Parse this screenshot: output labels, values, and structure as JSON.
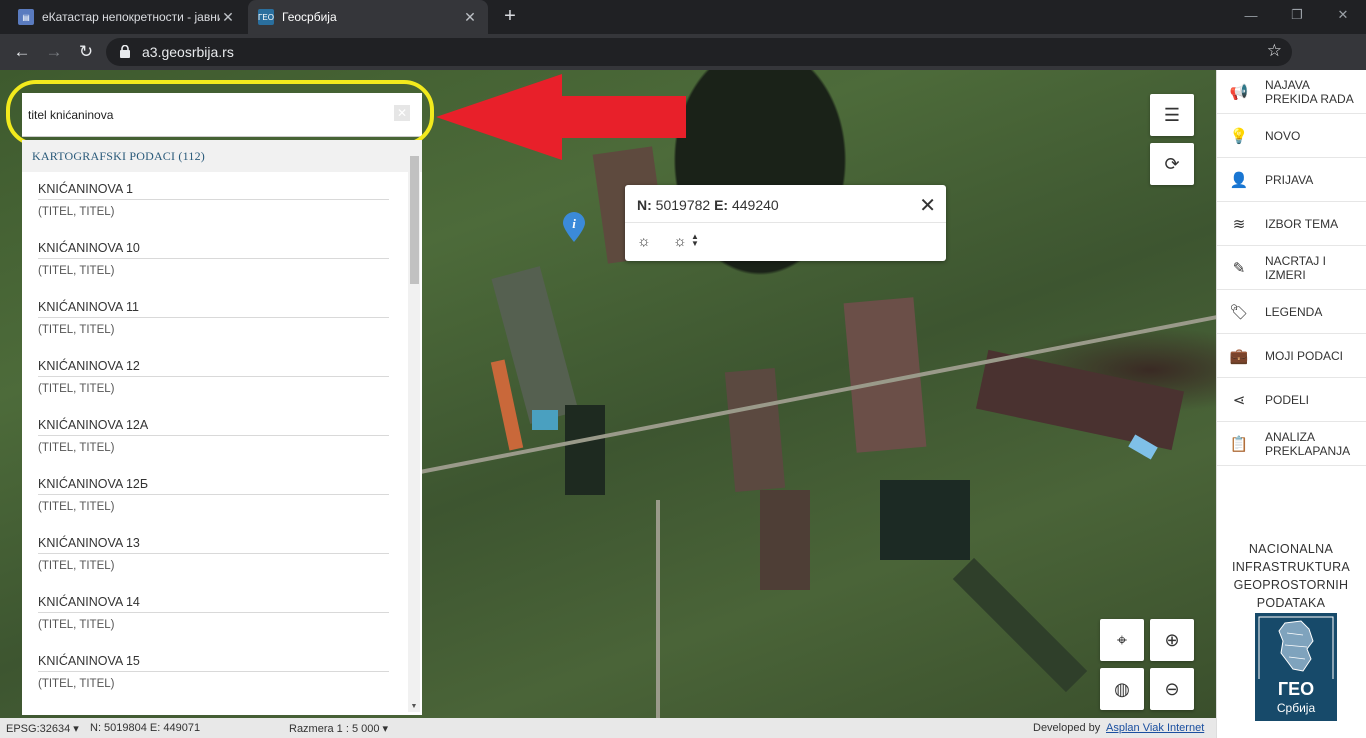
{
  "browser": {
    "tabs": [
      {
        "title": "еКатастар непокретности - јавни",
        "close": "✕"
      },
      {
        "title": "Геосрбија",
        "close": "✕"
      }
    ],
    "new_tab": "+",
    "url": "a3.geosrbija.rs"
  },
  "search": {
    "query": "titel knićaninova",
    "clear": "✕"
  },
  "results": {
    "header": "KARTOGRAFSKI PODACI (112)",
    "items": [
      {
        "name": "KNIĆANINOVA 1",
        "place": "(TITEL, TITEL)"
      },
      {
        "name": "KNIĆANINOVA 10",
        "place": "(TITEL, TITEL)"
      },
      {
        "name": "KNIĆANINOVA 11",
        "place": "(TITEL, TITEL)"
      },
      {
        "name": "KNIĆANINOVA 12",
        "place": "(TITEL, TITEL)"
      },
      {
        "name": "KNIĆANINOVA 12А",
        "place": "(TITEL, TITEL)"
      },
      {
        "name": "KNIĆANINOVA 12Б",
        "place": "(TITEL, TITEL)"
      },
      {
        "name": "KNIĆANINOVA 13",
        "place": "(TITEL, TITEL)"
      },
      {
        "name": "KNIĆANINOVA 14",
        "place": "(TITEL, TITEL)"
      },
      {
        "name": "KNIĆANINOVA 15",
        "place": "(TITEL, TITEL)"
      }
    ]
  },
  "popup": {
    "n_label": "N:",
    "n_value": "5019782",
    "e_label": "E:",
    "e_value": "449240",
    "close": "✕"
  },
  "sidebar": {
    "items": [
      {
        "label1": "NAJAVA",
        "label2": "PREKIDA RADA",
        "icon": "megaphone-icon"
      },
      {
        "label1": "NOVO",
        "label2": "",
        "icon": "lightbulb-icon"
      },
      {
        "label1": "PRIJAVA",
        "label2": "",
        "icon": "user-icon"
      },
      {
        "label1": "IZBOR TEMA",
        "label2": "",
        "icon": "layers-icon"
      },
      {
        "label1": "NACRTAJ I",
        "label2": "IZMERI",
        "icon": "pencil-icon"
      },
      {
        "label1": "LEGENDA",
        "label2": "",
        "icon": "tag-icon"
      },
      {
        "label1": "MOJI PODACI",
        "label2": "",
        "icon": "briefcase-icon"
      },
      {
        "label1": "PODELI",
        "label2": "",
        "icon": "share-icon"
      },
      {
        "label1": "ANALIZA",
        "label2": "PREKLAPANJA",
        "icon": "clipboard-icon"
      }
    ],
    "nipp": [
      "NACIONALNA",
      "INFRASTRUKTURA",
      "GEOPROSTORNIH",
      "PODATAKA"
    ],
    "logo_title": "ГЕО",
    "logo_sub": "Србија"
  },
  "statusbar": {
    "epsg": "EPSG:32634 ▾",
    "coords": "N: 5019804 E: 449071",
    "scale": "Razmera 1 : 5 000 ▾",
    "developed": "Developed by",
    "developer": "Asplan Viak Internet"
  }
}
